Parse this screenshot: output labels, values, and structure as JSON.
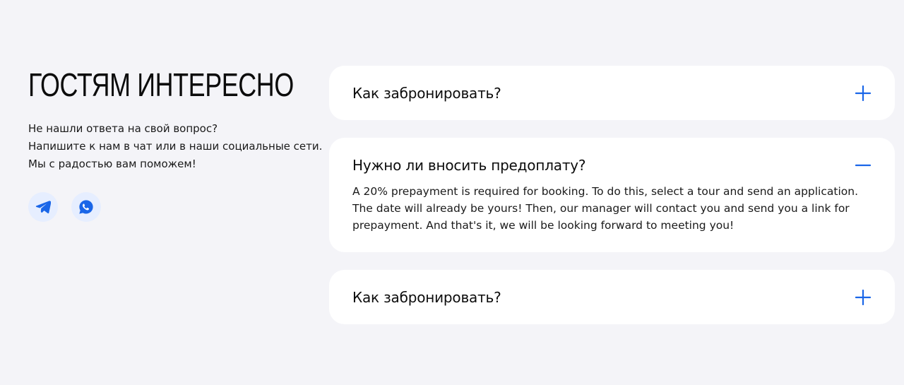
{
  "section": {
    "title": "ГОСТЯМ ИНТЕРЕСНО",
    "subtitle_lines": [
      "Не нашли ответа на свой вопрос?",
      "Напишите к нам в чат или в наши социальные сети.",
      "Мы с радостью вам поможем!"
    ]
  },
  "socials": [
    {
      "name": "telegram",
      "icon": "telegram-icon"
    },
    {
      "name": "whatsapp",
      "icon": "whatsapp-icon"
    }
  ],
  "faq": [
    {
      "question": "Как забронировать?",
      "expanded": false,
      "answer": ""
    },
    {
      "question": "Нужно ли вносить предоплату?",
      "expanded": true,
      "answer": "A 20% prepayment is required for booking. To do this, select a tour and send an application. The date will already be yours! Then, our manager will contact you and send you a link for prepayment. And that's it, we will be looking forward to meeting you!"
    },
    {
      "question": "Как забронировать?",
      "expanded": false,
      "answer": ""
    }
  ],
  "colors": {
    "background": "#f4f4f8",
    "card": "#ffffff",
    "accent": "#1a66e8",
    "social_bg": "#e6eeff"
  }
}
